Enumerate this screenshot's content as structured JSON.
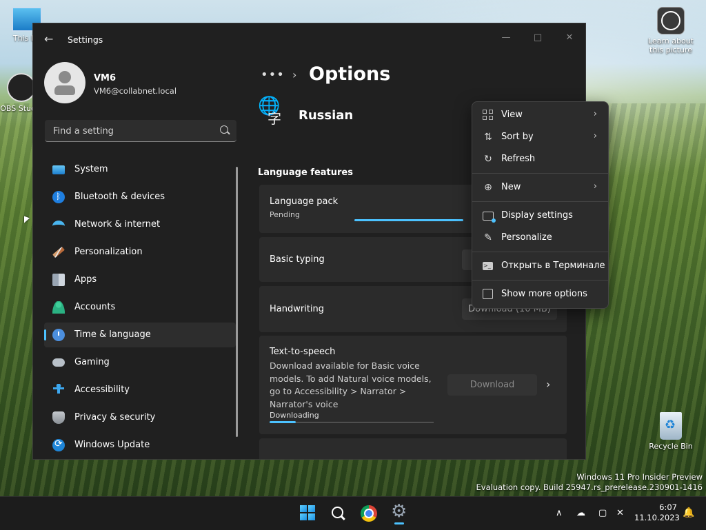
{
  "desktop": {
    "icons": [
      {
        "label": "This PC"
      },
      {
        "label": "OBS Studio"
      },
      {
        "label": "Learn about this picture"
      },
      {
        "label": "Recycle Bin"
      }
    ],
    "watermark": {
      "line1": "Windows 11 Pro Insider Preview",
      "line2": "Evaluation copy. Build 25947.rs_prerelease.230901-1416"
    }
  },
  "window": {
    "title": "Settings",
    "back_icon": "arrow-left-icon",
    "controls": {
      "minimize": "—",
      "maximize": "□",
      "close": "✕"
    }
  },
  "profile": {
    "name": "VM6",
    "email": "VM6@collabnet.local"
  },
  "search": {
    "placeholder": "Find a setting",
    "value": ""
  },
  "sidebar": {
    "items": [
      {
        "label": "System",
        "icon": "display-icon"
      },
      {
        "label": "Bluetooth & devices",
        "icon": "bluetooth-icon"
      },
      {
        "label": "Network & internet",
        "icon": "wifi-icon"
      },
      {
        "label": "Personalization",
        "icon": "brush-icon"
      },
      {
        "label": "Apps",
        "icon": "apps-icon"
      },
      {
        "label": "Accounts",
        "icon": "person-icon"
      },
      {
        "label": "Time & language",
        "icon": "clock-globe-icon",
        "selected": true
      },
      {
        "label": "Gaming",
        "icon": "gamepad-icon"
      },
      {
        "label": "Accessibility",
        "icon": "accessibility-icon"
      },
      {
        "label": "Privacy & security",
        "icon": "shield-icon"
      },
      {
        "label": "Windows Update",
        "icon": "update-icon"
      }
    ]
  },
  "main": {
    "breadcrumb_more": "•••",
    "breadcrumb_sep": "›",
    "page_title": "Options",
    "language": "Russian",
    "language_icon": "language-icon",
    "section_title": "Language features",
    "features": {
      "language_pack": {
        "title": "Language pack",
        "status": "Pending"
      },
      "basic_typing": {
        "title": "Basic typing"
      },
      "handwriting": {
        "title": "Handwriting",
        "button": "Download (10 MB)"
      },
      "tts": {
        "title": "Text-to-speech",
        "description": "Download available for Basic voice models. To add Natural voice models, go to Accessibility > Narrator > Narrator's voice",
        "status": "Downloading",
        "button": "Download",
        "chevron": "›",
        "progress": 0.16
      }
    }
  },
  "context_menu": {
    "items": [
      {
        "label": "View",
        "icon": "view-grid-icon",
        "submenu": true
      },
      {
        "label": "Sort by",
        "icon": "sort-icon",
        "submenu": true
      },
      {
        "label": "Refresh",
        "icon": "refresh-icon",
        "submenu": false
      },
      {
        "label": "New",
        "icon": "new-plus-icon",
        "submenu": true
      },
      {
        "label": "Display settings",
        "icon": "display-settings-icon",
        "submenu": false
      },
      {
        "label": "Personalize",
        "icon": "pen-icon",
        "submenu": false
      },
      {
        "label": "Открыть в Терминале",
        "icon": "terminal-icon",
        "submenu": false
      },
      {
        "label": "Show more options",
        "icon": "more-options-icon",
        "submenu": false
      }
    ],
    "chevron": "›"
  },
  "taskbar": {
    "tray_chevron": "∧",
    "time": "6:07",
    "date": "11.10.2023"
  },
  "colors": {
    "accent": "#4cc2ff",
    "window_bg": "#202020",
    "card_bg": "#2b2b2b",
    "menu_bg": "#2c2c2c"
  }
}
